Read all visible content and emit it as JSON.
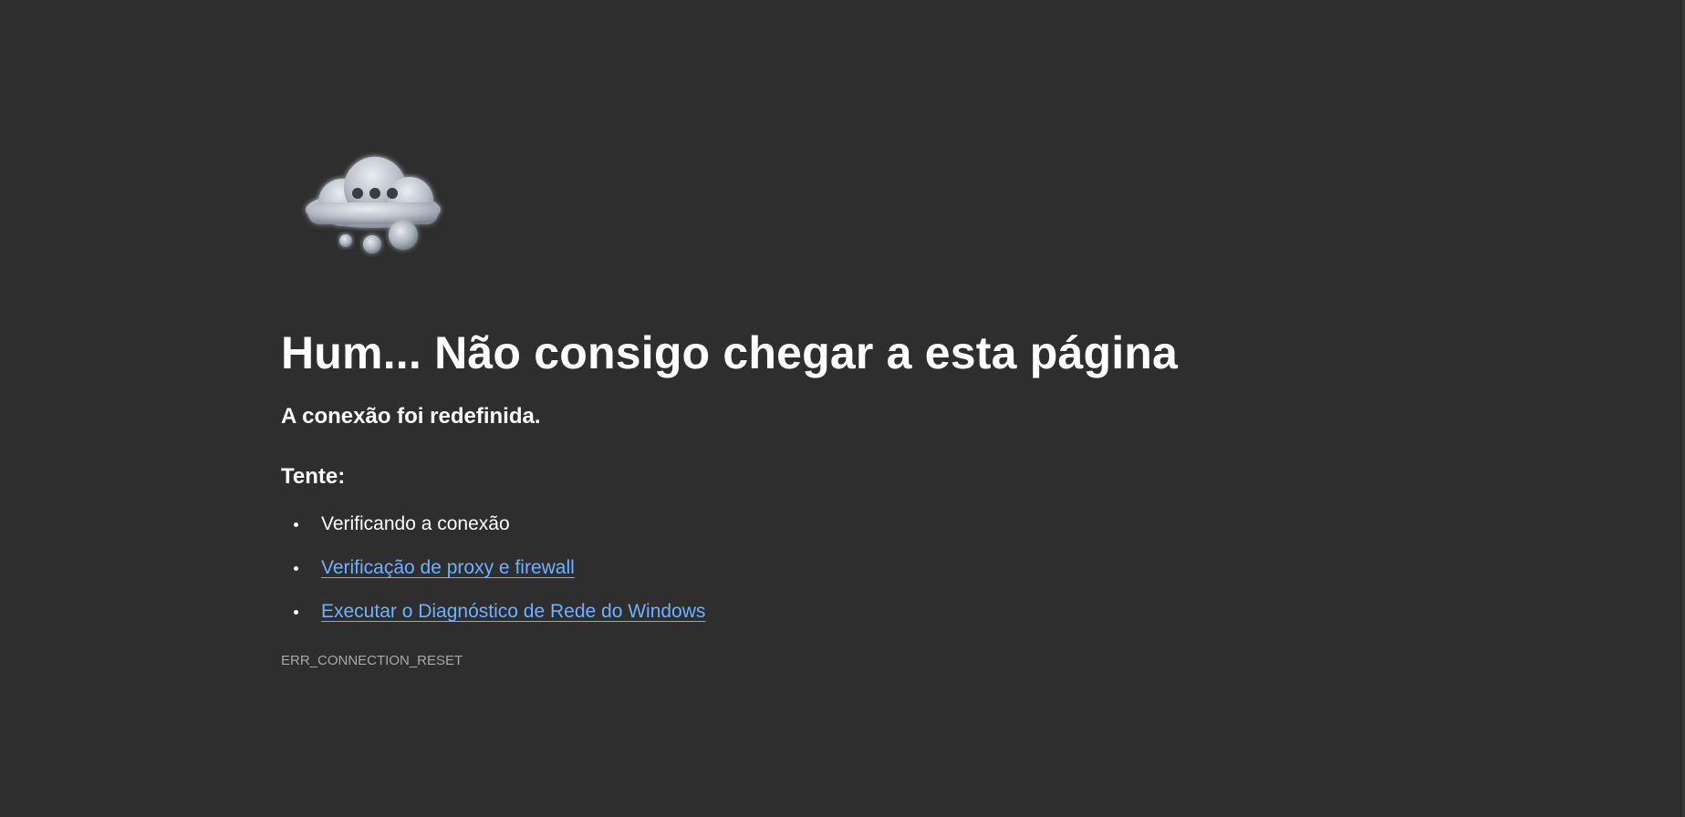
{
  "error_page": {
    "illustration_icon": "thinking-cloud-icon",
    "title": "Hum... Não consigo chegar a esta página",
    "subtitle": "A conexão foi redefinida.",
    "try_label": "Tente:",
    "suggestions": [
      {
        "label": "Verificando a conexão",
        "is_link": false
      },
      {
        "label": "Verificação de proxy e firewall",
        "is_link": true
      },
      {
        "label": "Executar o Diagnóstico de Rede do Windows",
        "is_link": true
      }
    ],
    "error_code": "ERR_CONNECTION_RESET"
  },
  "colors": {
    "background": "#2e2e2f",
    "text": "#ffffff",
    "link": "#6cb2ff",
    "muted": "#a8a8a8"
  }
}
